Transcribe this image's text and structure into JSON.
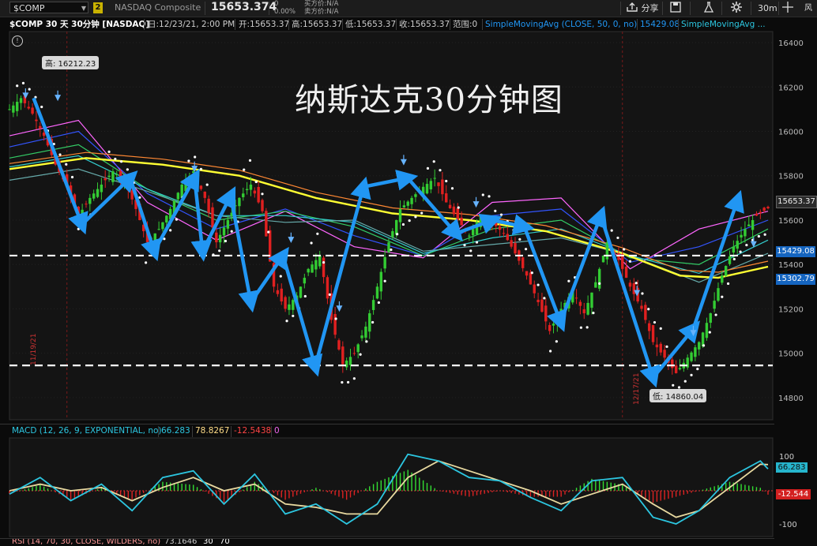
{
  "topbar": {
    "symbol": "$COMP",
    "badge": "2",
    "exchange_name": "NASDAQ Composite",
    "last_price": "15653.374",
    "change_value": "0",
    "change_pct": "0.00%",
    "bid": "买方价:N/A",
    "ask": "卖方价:N/A",
    "share_label": "分享",
    "timeframe": "30m",
    "more_label": "风"
  },
  "infobar": {
    "symbol_desc": "$COMP 30 天 30分钟 [NASDAQ]",
    "date": "日:12/23/21, 2:00 PM",
    "open": "开:15653.37",
    "high": "高:15653.37",
    "low": "低:15653.37",
    "close": "收:15653.37",
    "range": "范围:0",
    "sma1": "SimpleMovingAvg (CLOSE, 50, 0, no)",
    "sma1_value": "15429.08",
    "sma2": "SimpleMovingAvg ..."
  },
  "overlay_title": "纳斯达克30分钟图",
  "annotations": {
    "high_label": "高: 16212.23",
    "low_label": "低: 14860.04",
    "date1": "11/19/21",
    "date2": "12/17/21"
  },
  "price_tags": {
    "last": "15653.37",
    "sma50": "15429.08",
    "sma_other": "15302.79"
  },
  "macd": {
    "label": "MACD (12, 26, 9, EXPONENTIAL, no)",
    "value": "66.283",
    "avg": "78.8267",
    "diff": "-12.5438",
    "zero": "0",
    "tag_value": "66.283",
    "tag_diff": "-12.544",
    "axis_top": "100",
    "axis_bottom": "-100"
  },
  "rsi": {
    "label": "RSI (14, 70, 30, CLOSE, WILDERS, no)",
    "value": "73.1646",
    "ob": "30",
    "os": "70"
  },
  "colors": {
    "up": "#33cc33",
    "down": "#e02020",
    "sma50": "#ffff33",
    "arrow": "#2196f3",
    "ema_cyan": "#33cccc",
    "tag_blue": "#1565c0"
  },
  "chart_data": {
    "type": "candlestick",
    "ylim": [
      14700,
      16450
    ],
    "y_ticks": [
      16400,
      16200,
      16000,
      15800,
      15600,
      15400,
      15200,
      15000,
      14800
    ],
    "support_resistance": [
      15440,
      14945
    ],
    "close_path": [
      [
        0,
        16100
      ],
      [
        3,
        16150
      ],
      [
        6,
        16080
      ],
      [
        9,
        15980
      ],
      [
        12,
        15850
      ],
      [
        15,
        15750
      ],
      [
        18,
        15620
      ],
      [
        21,
        15700
      ],
      [
        24,
        15760
      ],
      [
        27,
        15820
      ],
      [
        30,
        15780
      ],
      [
        33,
        15650
      ],
      [
        36,
        15500
      ],
      [
        39,
        15560
      ],
      [
        42,
        15650
      ],
      [
        45,
        15760
      ],
      [
        48,
        15820
      ],
      [
        51,
        15700
      ],
      [
        54,
        15500
      ],
      [
        57,
        15600
      ],
      [
        60,
        15700
      ],
      [
        63,
        15760
      ],
      [
        66,
        15640
      ],
      [
        69,
        15300
      ],
      [
        72,
        15200
      ],
      [
        75,
        15260
      ],
      [
        78,
        15380
      ],
      [
        81,
        15440
      ],
      [
        84,
        15150
      ],
      [
        87,
        14950
      ],
      [
        90,
        15000
      ],
      [
        93,
        15120
      ],
      [
        96,
        15300
      ],
      [
        99,
        15500
      ],
      [
        102,
        15650
      ],
      [
        105,
        15700
      ],
      [
        108,
        15750
      ],
      [
        111,
        15790
      ],
      [
        114,
        15680
      ],
      [
        117,
        15600
      ],
      [
        120,
        15530
      ],
      [
        123,
        15620
      ],
      [
        126,
        15590
      ],
      [
        129,
        15540
      ],
      [
        132,
        15450
      ],
      [
        135,
        15350
      ],
      [
        138,
        15230
      ],
      [
        141,
        15100
      ],
      [
        144,
        15200
      ],
      [
        147,
        15280
      ],
      [
        150,
        15180
      ],
      [
        153,
        15320
      ],
      [
        156,
        15500
      ],
      [
        159,
        15420
      ],
      [
        162,
        15300
      ],
      [
        165,
        15200
      ],
      [
        168,
        15050
      ],
      [
        171,
        14980
      ],
      [
        174,
        14910
      ],
      [
        177,
        14980
      ],
      [
        180,
        15050
      ],
      [
        183,
        15180
      ],
      [
        186,
        15350
      ],
      [
        189,
        15480
      ],
      [
        192,
        15560
      ],
      [
        195,
        15620
      ],
      [
        198,
        15653
      ]
    ],
    "sma50": [
      [
        0,
        15830
      ],
      [
        20,
        15880
      ],
      [
        40,
        15850
      ],
      [
        60,
        15800
      ],
      [
        80,
        15700
      ],
      [
        100,
        15630
      ],
      [
        120,
        15600
      ],
      [
        140,
        15550
      ],
      [
        160,
        15450
      ],
      [
        175,
        15350
      ],
      [
        185,
        15340
      ],
      [
        198,
        15390
      ]
    ],
    "macd_line": [
      [
        0,
        -10
      ],
      [
        8,
        40
      ],
      [
        16,
        -30
      ],
      [
        24,
        20
      ],
      [
        32,
        -60
      ],
      [
        40,
        40
      ],
      [
        48,
        60
      ],
      [
        56,
        -40
      ],
      [
        64,
        50
      ],
      [
        72,
        -70
      ],
      [
        80,
        -40
      ],
      [
        88,
        -100
      ],
      [
        96,
        -40
      ],
      [
        104,
        110
      ],
      [
        112,
        90
      ],
      [
        120,
        40
      ],
      [
        128,
        30
      ],
      [
        136,
        -20
      ],
      [
        144,
        -60
      ],
      [
        152,
        30
      ],
      [
        160,
        40
      ],
      [
        168,
        -80
      ],
      [
        174,
        -100
      ],
      [
        180,
        -60
      ],
      [
        188,
        40
      ],
      [
        196,
        90
      ],
      [
        198,
        66
      ]
    ],
    "signal_line": [
      [
        0,
        0
      ],
      [
        8,
        20
      ],
      [
        16,
        0
      ],
      [
        24,
        10
      ],
      [
        32,
        -30
      ],
      [
        40,
        10
      ],
      [
        48,
        40
      ],
      [
        56,
        0
      ],
      [
        64,
        20
      ],
      [
        72,
        -40
      ],
      [
        80,
        -50
      ],
      [
        88,
        -70
      ],
      [
        96,
        -70
      ],
      [
        104,
        40
      ],
      [
        112,
        90
      ],
      [
        120,
        60
      ],
      [
        128,
        30
      ],
      [
        136,
        0
      ],
      [
        144,
        -40
      ],
      [
        152,
        -10
      ],
      [
        160,
        20
      ],
      [
        168,
        -40
      ],
      [
        174,
        -80
      ],
      [
        180,
        -60
      ],
      [
        188,
        10
      ],
      [
        196,
        80
      ],
      [
        198,
        79
      ]
    ],
    "ema_fan": [
      [
        15980,
        16050,
        15680,
        15510,
        15640,
        15480,
        15430,
        15680,
        15700,
        15380,
        15560,
        15640
      ],
      [
        15930,
        16000,
        15720,
        15560,
        15650,
        15530,
        15440,
        15620,
        15650,
        15410,
        15480,
        15600
      ],
      [
        15880,
        15940,
        15740,
        15600,
        15640,
        15570,
        15440,
        15560,
        15600,
        15430,
        15400,
        15560
      ],
      [
        15840,
        15890,
        15740,
        15620,
        15620,
        15590,
        15450,
        15520,
        15560,
        15440,
        15360,
        15510
      ],
      [
        15780,
        15830,
        15730,
        15620,
        15590,
        15600,
        15460,
        15490,
        15520,
        15440,
        15320,
        15450
      ]
    ]
  }
}
